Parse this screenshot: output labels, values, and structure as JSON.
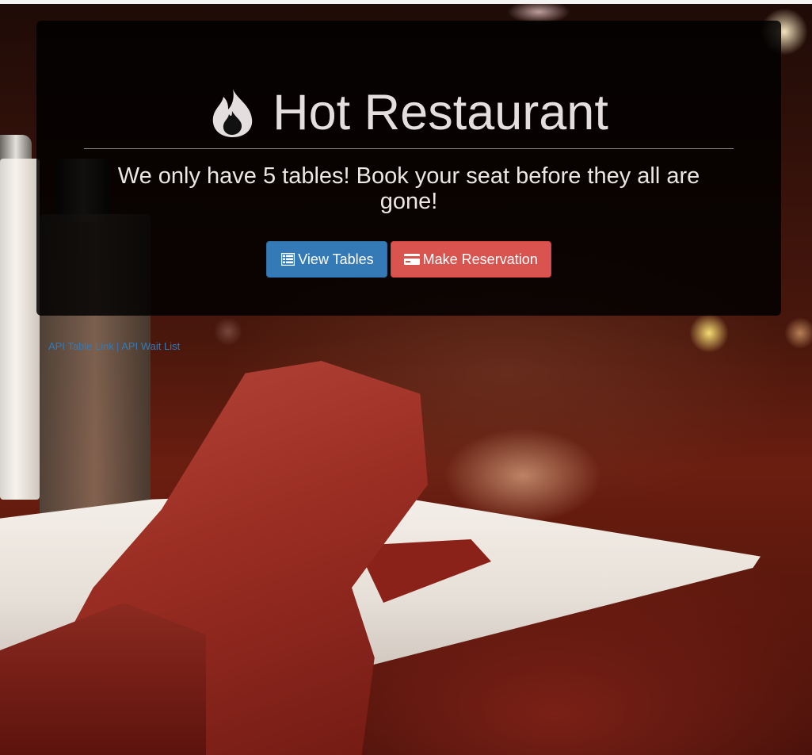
{
  "jumbotron": {
    "title": "Hot Restaurant",
    "title_icon": "fire-icon",
    "lead": "We only have 5 tables! Book your seat before they all are gone!",
    "buttons": {
      "view_tables": {
        "label": "View Tables",
        "icon": "table-list-icon",
        "color": "#337ab7"
      },
      "make_reservation": {
        "label": "Make Reservation",
        "icon": "credit-card-icon",
        "color": "#d9534f"
      }
    }
  },
  "footer_links": {
    "api_table_link": "API Table Link",
    "separator": "|",
    "api_wait_list": "API Wait List"
  },
  "background": {
    "description_color": "#4a170c"
  }
}
